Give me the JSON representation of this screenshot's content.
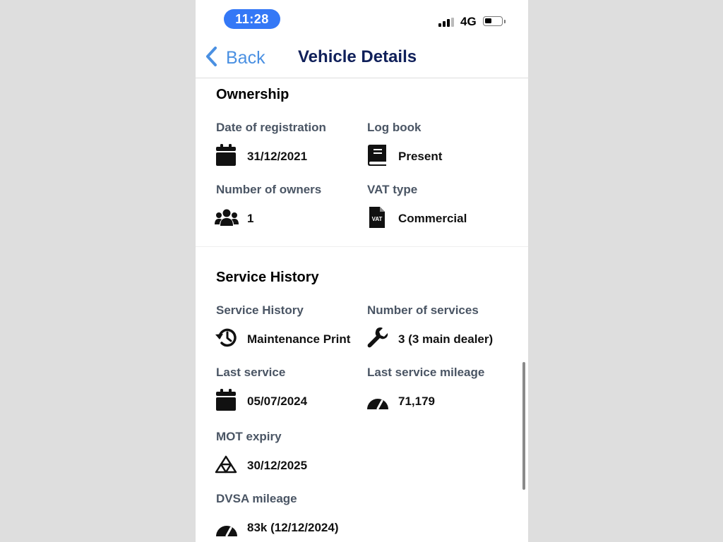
{
  "status_bar": {
    "time": "11:28",
    "network": "4G"
  },
  "nav": {
    "back_label": "Back",
    "title": "Vehicle Details"
  },
  "ownership": {
    "title": "Ownership",
    "date_of_registration": {
      "label": "Date of registration",
      "value": "31/12/2021",
      "icon": "calendar-icon"
    },
    "log_book": {
      "label": "Log book",
      "value": "Present",
      "icon": "book-icon"
    },
    "number_of_owners": {
      "label": "Number of owners",
      "value": "1",
      "icon": "users-icon"
    },
    "vat_type": {
      "label": "VAT type",
      "value": "Commercial",
      "icon": "vat-document-icon",
      "icon_text": "VAT"
    }
  },
  "service_history": {
    "title": "Service History",
    "service_history": {
      "label": "Service History",
      "value": "Maintenance Print",
      "icon": "history-icon"
    },
    "number_of_services": {
      "label": "Number of services",
      "value": "3 (3 main dealer)",
      "icon": "wrench-icon"
    },
    "last_service": {
      "label": "Last service",
      "value": "05/07/2024",
      "icon": "calendar-icon"
    },
    "last_service_mileage": {
      "label": "Last service mileage",
      "value": "71,179",
      "icon": "speedometer-icon"
    },
    "mot_expiry": {
      "label": "MOT expiry",
      "value": "30/12/2025",
      "icon": "mot-triangles-icon"
    },
    "dvsa_mileage": {
      "label": "DVSA mileage",
      "value": "83k (12/12/2024)",
      "icon": "speedometer-icon"
    }
  },
  "colors": {
    "accent": "#3478f6",
    "back_link": "#4a90e2",
    "title": "#10205a",
    "label": "#4a5564"
  }
}
